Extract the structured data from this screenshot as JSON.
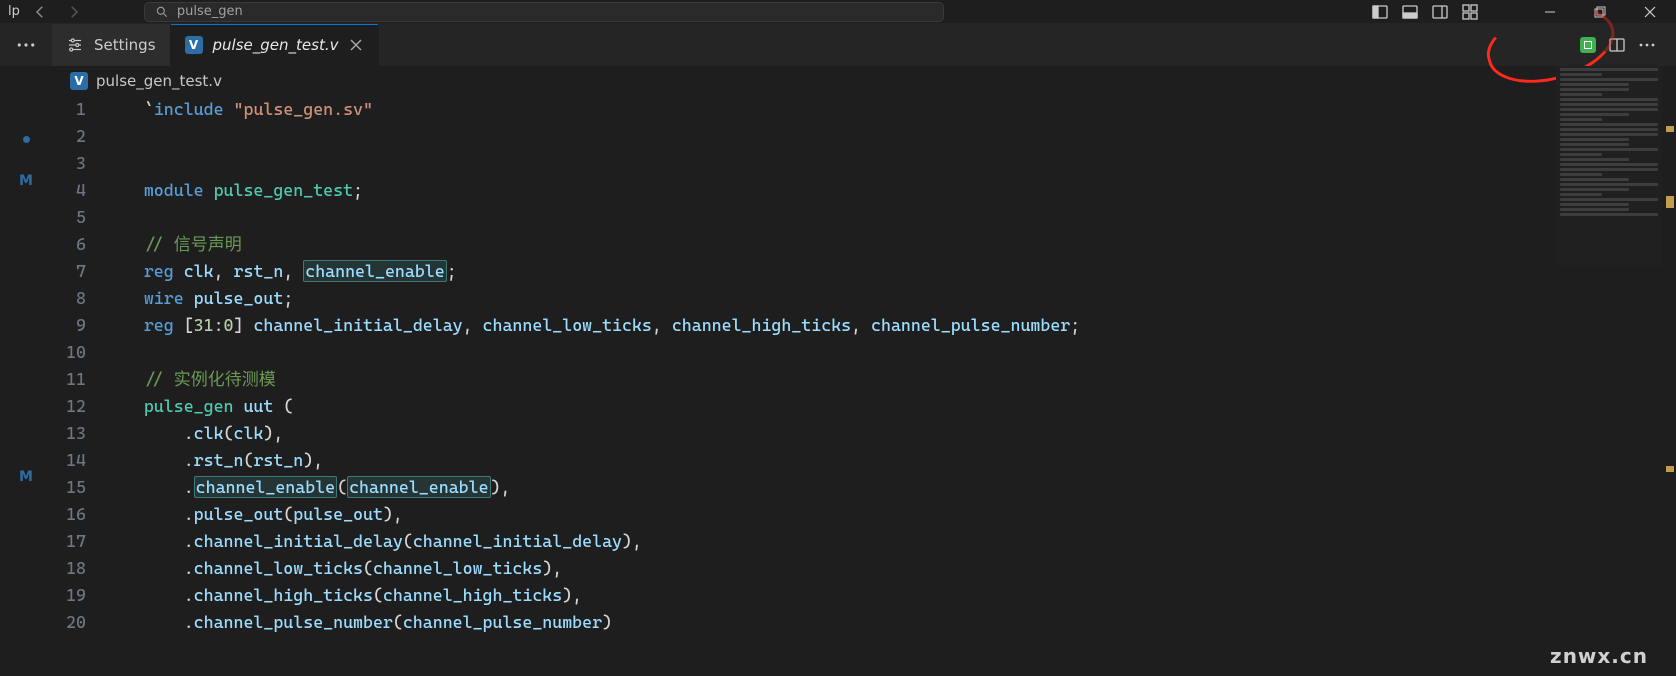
{
  "menu_stub": "lp",
  "search": {
    "text": "pulse_gen"
  },
  "tabs": {
    "settings_label": "Settings",
    "file_label": "pulse_gen_test.v"
  },
  "breadcrumb": {
    "file": "pulse_gen_test.v"
  },
  "gutter": {
    "m1": "M",
    "m2": "M"
  },
  "code": {
    "l1": {
      "n": "1",
      "pre": "    ",
      "tok": [
        [
          "punct",
          "`"
        ],
        [
          "kw",
          "include"
        ],
        [
          "punct",
          " "
        ],
        [
          "str",
          "\"pulse_gen.sv\""
        ]
      ]
    },
    "l2": {
      "n": "2",
      "pre": "",
      "tok": []
    },
    "l3": {
      "n": "3",
      "pre": "",
      "tok": []
    },
    "l4": {
      "n": "4",
      "pre": "    ",
      "tok": [
        [
          "kw",
          "module"
        ],
        [
          "punct",
          " "
        ],
        [
          "type",
          "pulse_gen_test"
        ],
        [
          "punct",
          ";"
        ]
      ]
    },
    "l5": {
      "n": "5",
      "pre": "",
      "tok": []
    },
    "l6": {
      "n": "6",
      "pre": "    ",
      "tok": [
        [
          "cmt",
          "// 信号声明"
        ]
      ]
    },
    "l7": {
      "n": "7",
      "pre": "    ",
      "tok": [
        [
          "kw",
          "reg"
        ],
        [
          "punct",
          " "
        ],
        [
          "fn",
          "clk"
        ],
        [
          "punct",
          ", "
        ],
        [
          "fn",
          "rst_n"
        ],
        [
          "punct",
          ", "
        ],
        [
          "hl",
          "channel_enable"
        ],
        [
          "punct",
          ";"
        ]
      ]
    },
    "l8": {
      "n": "8",
      "pre": "    ",
      "tok": [
        [
          "kw",
          "wire"
        ],
        [
          "punct",
          " "
        ],
        [
          "fn",
          "pulse_out"
        ],
        [
          "punct",
          ";"
        ]
      ]
    },
    "l9": {
      "n": "9",
      "pre": "    ",
      "tok": [
        [
          "kw",
          "reg"
        ],
        [
          "punct",
          " ["
        ],
        [
          "num",
          "31"
        ],
        [
          "punct",
          ":"
        ],
        [
          "num",
          "0"
        ],
        [
          "punct",
          "] "
        ],
        [
          "fn",
          "channel_initial_delay"
        ],
        [
          "punct",
          ", "
        ],
        [
          "fn",
          "channel_low_ticks"
        ],
        [
          "punct",
          ", "
        ],
        [
          "fn",
          "channel_high_ticks"
        ],
        [
          "punct",
          ", "
        ],
        [
          "fn",
          "channel_pulse_number"
        ],
        [
          "punct",
          ";"
        ]
      ]
    },
    "l10": {
      "n": "10",
      "pre": "",
      "tok": []
    },
    "l11": {
      "n": "11",
      "pre": "    ",
      "tok": [
        [
          "cmt",
          "// 实例化待测模"
        ]
      ]
    },
    "l12": {
      "n": "12",
      "pre": "    ",
      "tok": [
        [
          "type",
          "pulse_gen"
        ],
        [
          "punct",
          " "
        ],
        [
          "fn",
          "uut"
        ],
        [
          "punct",
          " ("
        ]
      ]
    },
    "l13": {
      "n": "13",
      "pre": "        ",
      "tok": [
        [
          "punct",
          "."
        ],
        [
          "fn",
          "clk"
        ],
        [
          "punct",
          "("
        ],
        [
          "fn",
          "clk"
        ],
        [
          "punct",
          "),"
        ]
      ]
    },
    "l14": {
      "n": "14",
      "pre": "        ",
      "tok": [
        [
          "punct",
          "."
        ],
        [
          "fn",
          "rst_n"
        ],
        [
          "punct",
          "("
        ],
        [
          "fn",
          "rst_n"
        ],
        [
          "punct",
          "),"
        ]
      ]
    },
    "l15": {
      "n": "15",
      "pre": "        ",
      "tok": [
        [
          "punct",
          "."
        ],
        [
          "hl",
          "channel_enable"
        ],
        [
          "punct",
          "("
        ],
        [
          "hl",
          "channel_enable"
        ],
        [
          "punct",
          "),"
        ]
      ]
    },
    "l16": {
      "n": "16",
      "pre": "        ",
      "tok": [
        [
          "punct",
          "."
        ],
        [
          "fn",
          "pulse_out"
        ],
        [
          "punct",
          "("
        ],
        [
          "fn",
          "pulse_out"
        ],
        [
          "punct",
          "),"
        ]
      ]
    },
    "l17": {
      "n": "17",
      "pre": "        ",
      "tok": [
        [
          "punct",
          "."
        ],
        [
          "fn",
          "channel_initial_delay"
        ],
        [
          "punct",
          "("
        ],
        [
          "fn",
          "channel_initial_delay"
        ],
        [
          "punct",
          "),"
        ]
      ]
    },
    "l18": {
      "n": "18",
      "pre": "        ",
      "tok": [
        [
          "punct",
          "."
        ],
        [
          "fn",
          "channel_low_ticks"
        ],
        [
          "punct",
          "("
        ],
        [
          "fn",
          "channel_low_ticks"
        ],
        [
          "punct",
          "),"
        ]
      ]
    },
    "l19": {
      "n": "19",
      "pre": "        ",
      "tok": [
        [
          "punct",
          "."
        ],
        [
          "fn",
          "channel_high_ticks"
        ],
        [
          "punct",
          "("
        ],
        [
          "fn",
          "channel_high_ticks"
        ],
        [
          "punct",
          "),"
        ]
      ]
    },
    "l20": {
      "n": "20",
      "pre": "        ",
      "tok": [
        [
          "punct",
          "."
        ],
        [
          "fn",
          "channel_pulse_number"
        ],
        [
          "punct",
          "("
        ],
        [
          "fn",
          "channel_pulse_number"
        ],
        [
          "punct",
          ")"
        ]
      ]
    }
  },
  "watermark": "znwx.cn",
  "colors": {
    "bg": "#1e1e1e",
    "accent": "#2a6ea5",
    "keyword": "#569cd6",
    "string": "#ce9178",
    "comment": "#6a9955",
    "identifier": "#9cdcfe",
    "type": "#4ec9b0",
    "number": "#b5cea8",
    "highlight-border": "#3c7a7a",
    "annotation-red": "#ff2a1a",
    "chip-green": "#3fb24f"
  }
}
